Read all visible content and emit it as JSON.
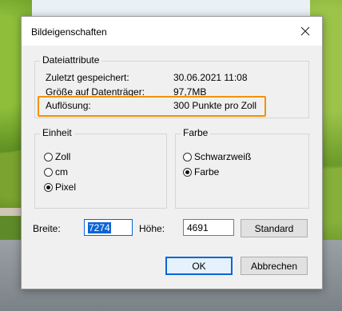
{
  "dialog": {
    "title": "Bildeigenschaften",
    "close_glyph": "close-icon"
  },
  "file_attributes": {
    "group_label": "Dateiattribute",
    "rows": [
      {
        "label": "Zuletzt gespeichert:",
        "value": "30.06.2021 11:08"
      },
      {
        "label": "Größe auf Datenträger:",
        "value": "97,7MB"
      },
      {
        "label": "Auflösung:",
        "value": "300 Punkte pro Zoll"
      }
    ],
    "highlight_color": "#f39200"
  },
  "unit": {
    "group_label": "Einheit",
    "options": [
      "Zoll",
      "cm",
      "Pixel"
    ],
    "selected": "Pixel"
  },
  "color": {
    "group_label": "Farbe",
    "options": [
      "Schwarzweiß",
      "Farbe"
    ],
    "selected": "Farbe"
  },
  "size": {
    "width_label": "Breite:",
    "width_value": "7274",
    "height_label": "Höhe:",
    "height_value": "4691",
    "standard_button": "Standard"
  },
  "buttons": {
    "ok": "OK",
    "cancel": "Abbrechen"
  }
}
